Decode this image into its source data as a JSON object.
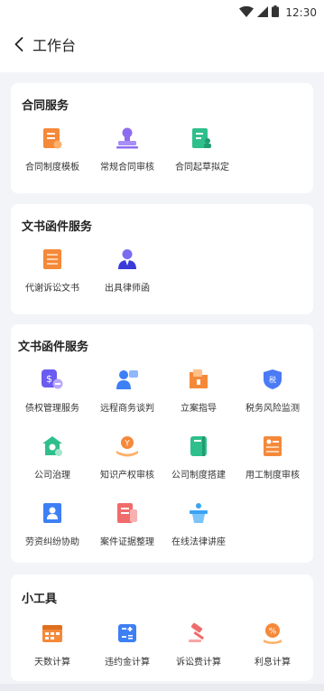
{
  "status_bar": {
    "time": "12:30",
    "icons": [
      "wifi-icon",
      "signal-icon",
      "battery-icon"
    ]
  },
  "header": {
    "title": "工作台",
    "back_icon": "chevron-left-icon"
  },
  "sections": [
    {
      "title": "合同服务",
      "items": [
        {
          "label": "合同制度模板",
          "icon": "document-badge-icon",
          "color": "#f5893a"
        },
        {
          "label": "常规合同审核",
          "icon": "stamp-icon",
          "color": "#8e6cf0"
        },
        {
          "label": "合同起草拟定",
          "icon": "contract-draft-icon",
          "color": "#2fbf8c"
        }
      ]
    },
    {
      "title": "文书函件服务",
      "items": [
        {
          "label": "代谢诉讼文书",
          "icon": "list-document-icon",
          "color": "#f5893a"
        },
        {
          "label": "出具律师函",
          "icon": "lawyer-icon",
          "color": "#5a55e6"
        }
      ]
    },
    {
      "title": "文书函件服务",
      "items": [
        {
          "label": "债权管理服务",
          "icon": "money-bag-icon",
          "color": "#6a5cf0"
        },
        {
          "label": "远程商务谈判",
          "icon": "negotiation-icon",
          "color": "#3d7ff5"
        },
        {
          "label": "立案指导",
          "icon": "folder-icon",
          "color": "#f5893a"
        },
        {
          "label": "税务风险监测",
          "icon": "tax-shield-icon",
          "color": "#4a7af5"
        },
        {
          "label": "公司治理",
          "icon": "company-house-icon",
          "color": "#2fbf8c"
        },
        {
          "label": "知识产权审核",
          "icon": "trademark-icon",
          "color": "#f5893a"
        },
        {
          "label": "公司制度搭建",
          "icon": "book-icon",
          "color": "#2fbf8c"
        },
        {
          "label": "用工制度审核",
          "icon": "employee-doc-icon",
          "color": "#f5893a"
        },
        {
          "label": "劳资纠纷协助",
          "icon": "person-card-icon",
          "color": "#3d7ff5"
        },
        {
          "label": "案件证据整理",
          "icon": "evidence-icon",
          "color": "#f06b6b"
        },
        {
          "label": "在线法律讲座",
          "icon": "lecture-podium-icon",
          "color": "#3aa3f5"
        }
      ]
    },
    {
      "title": "小工具",
      "items": [
        {
          "label": "天数计算",
          "icon": "calendar-icon",
          "color": "#f5893a"
        },
        {
          "label": "违约金计算",
          "icon": "calculator-icon",
          "color": "#3d7ff5"
        },
        {
          "label": "诉讼费计算",
          "icon": "gavel-icon",
          "color": "#f06b6b"
        },
        {
          "label": "利息计算",
          "icon": "percent-coin-icon",
          "color": "#f5893a"
        }
      ]
    }
  ]
}
